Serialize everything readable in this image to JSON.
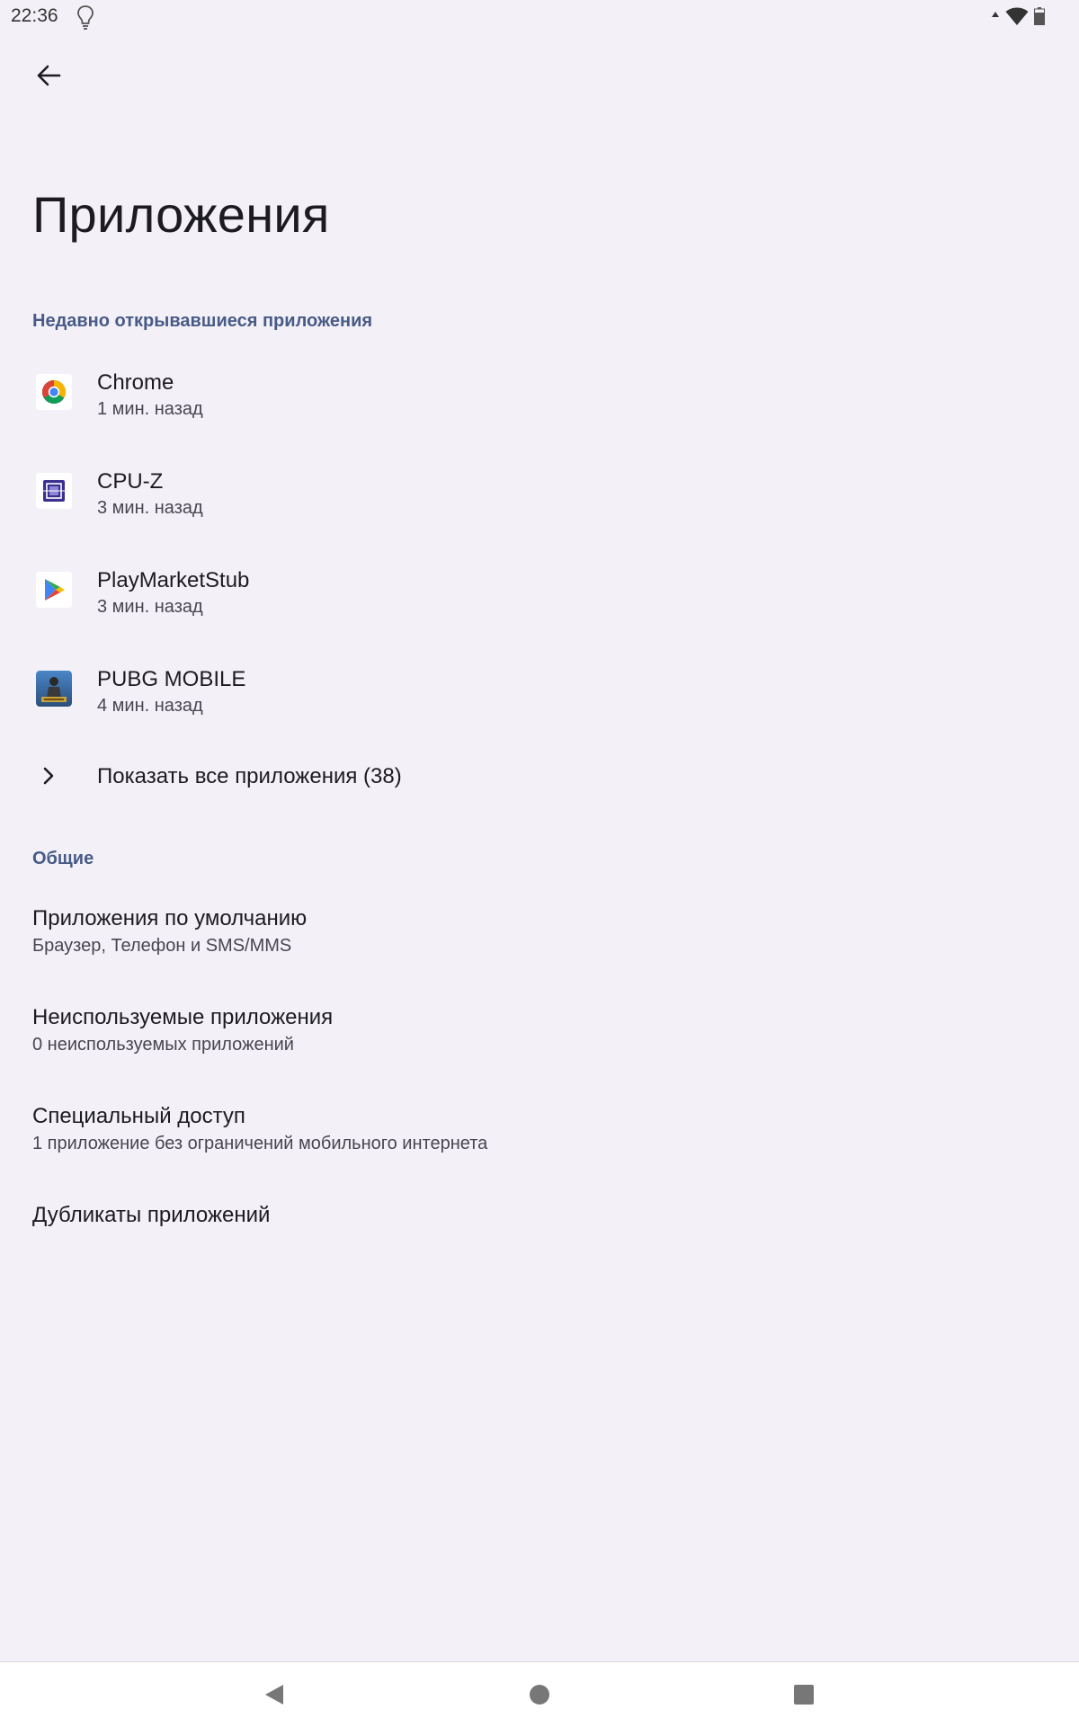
{
  "status_bar": {
    "time": "22:36",
    "icons": [
      "lightbulb-icon",
      "wifi-icon",
      "battery-icon"
    ]
  },
  "header": {
    "title": "Приложения",
    "back_icon": "arrow-left-icon"
  },
  "recent": {
    "section_title": "Недавно открывавшиеся приложения",
    "apps": [
      {
        "name": "Chrome",
        "time": "1 мин. назад",
        "icon": "chrome-icon"
      },
      {
        "name": "CPU-Z",
        "time": "3 мин. назад",
        "icon": "cpu-z-icon"
      },
      {
        "name": "PlayMarketStub",
        "time": "3 мин. назад",
        "icon": "play-market-icon"
      },
      {
        "name": "PUBG MOBILE",
        "time": "4 мин. назад",
        "icon": "pubg-icon"
      }
    ],
    "show_all_label": "Показать все приложения (38)"
  },
  "general": {
    "section_title": "Общие",
    "items": [
      {
        "title": "Приложения по умолчанию",
        "subtitle": "Браузер, Телефон и SMS/MMS"
      },
      {
        "title": "Неиспользуемые приложения",
        "subtitle": "0 неиспользуемых приложений"
      },
      {
        "title": "Специальный доступ",
        "subtitle": "1 приложение без ограничений мобильного интернета"
      },
      {
        "title": "Дубликаты приложений",
        "subtitle": ""
      }
    ]
  },
  "nav_bar": {
    "buttons": [
      "back-triangle-icon",
      "home-circle-icon",
      "recents-square-icon"
    ]
  },
  "colors": {
    "background": "#f3f1f7",
    "section_header": "#485a86",
    "primary_text": "#1c1b1f",
    "secondary_text": "#49454f"
  }
}
